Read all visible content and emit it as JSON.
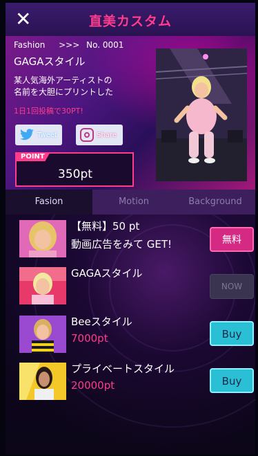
{
  "header": {
    "close_icon": "close-icon",
    "title": "直美カスタム"
  },
  "info": {
    "category": "Fashion",
    "number": "No. 0001",
    "arrows": ">>>",
    "style_name": "GAGAスタイル",
    "description_line1": "某人気海外アーティストの",
    "description_line2": "名前を大胆にプリントした",
    "daily_bonus": "1日1回投稿で30PT!",
    "tweet_label": "Tweet",
    "share_label": "Share",
    "point_tag": "POINT",
    "point_value": "350pt"
  },
  "tabs": [
    {
      "label": "Fasion",
      "active": true
    },
    {
      "label": "Motion",
      "active": false
    },
    {
      "label": "Background",
      "active": false
    }
  ],
  "items": [
    {
      "title": "【無料】50 pt",
      "subtitle": "動画広告をみて GET!",
      "button": "無料"
    },
    {
      "title": "GAGAスタイル",
      "subtitle": "",
      "button": "NOW"
    },
    {
      "title": "Beeスタイル",
      "subtitle": "7000pt",
      "button": "Buy"
    },
    {
      "title": "プライベートスタイル",
      "subtitle": "20000pt",
      "button": "Buy"
    }
  ],
  "colors": {
    "accent": "#ff3c8c",
    "buy": "#2bbfd6",
    "header": "#2a1252"
  }
}
